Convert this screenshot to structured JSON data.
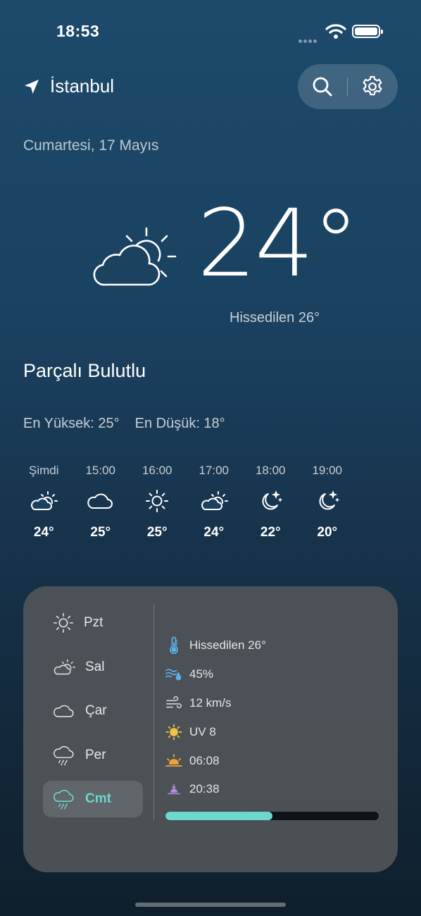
{
  "status_bar": {
    "time": "18:53"
  },
  "header": {
    "city": "İstanbul",
    "date": "Cumartesi, 17 Mayıs"
  },
  "current": {
    "temperature": "24°",
    "feels_like": "Hissedilen 26°",
    "condition": "Parçalı Bulutlu",
    "high": "En Yüksek: 25°",
    "low": "En Düşük: 18°"
  },
  "hourly": [
    {
      "time": "Şimdi",
      "icon": "partly-cloudy-icon",
      "temp": "24°"
    },
    {
      "time": "15:00",
      "icon": "cloud-icon",
      "temp": "25°"
    },
    {
      "time": "16:00",
      "icon": "sun-icon",
      "temp": "25°"
    },
    {
      "time": "17:00",
      "icon": "partly-cloudy-icon",
      "temp": "24°"
    },
    {
      "time": "18:00",
      "icon": "moon-stars-icon",
      "temp": "22°"
    },
    {
      "time": "19:00",
      "icon": "moon-stars-icon",
      "temp": "20°"
    }
  ],
  "days": [
    {
      "label": "Pzt",
      "icon": "sun-icon"
    },
    {
      "label": "Sal",
      "icon": "partly-cloudy-icon"
    },
    {
      "label": "Çar",
      "icon": "cloud-icon"
    },
    {
      "label": "Per",
      "icon": "rain-icon"
    },
    {
      "label": "Cmt",
      "icon": "rain-icon",
      "selected": true
    }
  ],
  "details": {
    "feels_like": "Hissedilen 26°",
    "humidity": "45%",
    "wind": "12 km/s",
    "uv": "UV 8",
    "sunrise": "06:08",
    "sunset": "20:38"
  },
  "progress_fraction": 0.5,
  "colors": {
    "accent": "#6dd6cf",
    "uv": "#f2c443",
    "sunrise": "#f0a43a",
    "sunset": "#b48ce0",
    "humidity": "#5bb2e8"
  }
}
